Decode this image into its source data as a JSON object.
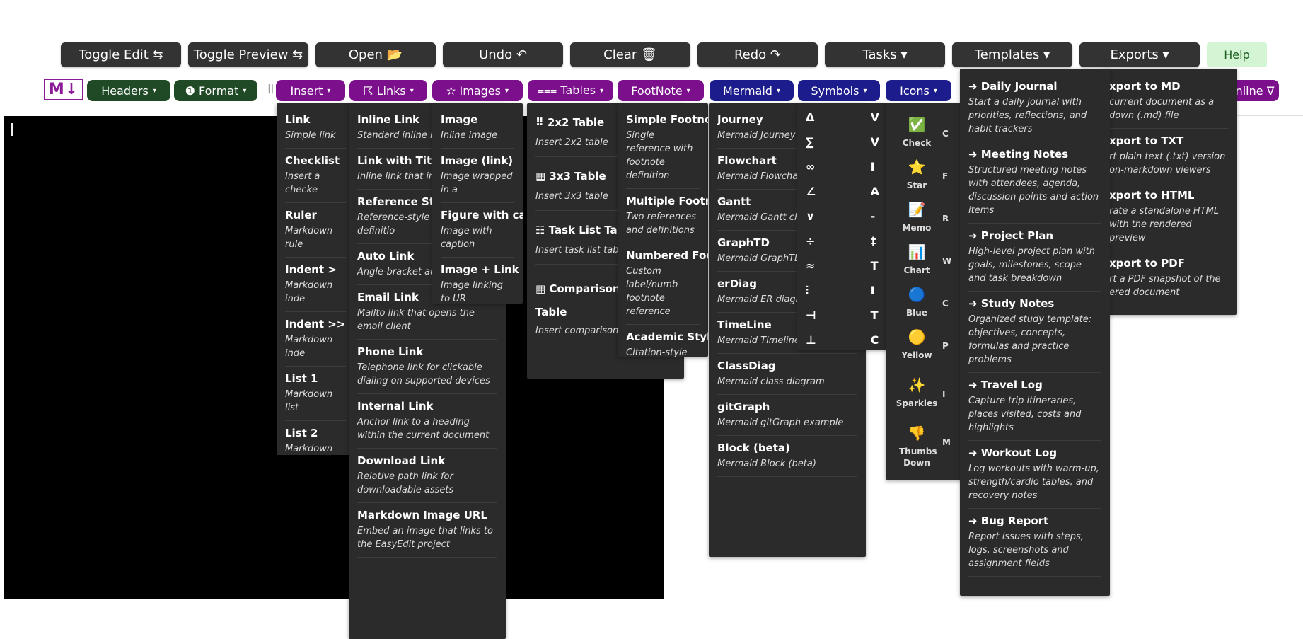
{
  "toolbar": {
    "toggle_edit": "Toggle Edit ⇆",
    "toggle_preview": "Toggle Preview ⇆",
    "open": "Open 📂",
    "undo": "Undo ↶",
    "clear": "Clear 🗑",
    "redo": "Redo ↷",
    "tasks": "Tasks ▾",
    "templates": "Templates ▾",
    "exports": "Exports ▾",
    "help": "Help"
  },
  "formatbar": {
    "logo": "M↓",
    "headers": "Headers",
    "format": "❶ Format",
    "insert": "Insert",
    "links": "☈ Links",
    "images": "✫ Images",
    "tables": "⩶ Tables",
    "footnote": "FootNote",
    "mermaid": "Mermaid",
    "symbols": "Symbols",
    "icons": "Icons",
    "inline": "nline ∇",
    "caret": "▾",
    "separator": "||"
  },
  "insert_menu": [
    {
      "title": "Link",
      "desc": "Simple link"
    },
    {
      "title": "Checklist",
      "desc": "Insert a checke"
    },
    {
      "title": "Ruler",
      "desc": "Markdown rule"
    },
    {
      "title": "Indent >",
      "desc": "Markdown inde"
    },
    {
      "title": "Indent >>",
      "desc": "Markdown inde"
    },
    {
      "title": "List 1",
      "desc": "Markdown list"
    },
    {
      "title": "List 2",
      "desc": "Markdown list"
    }
  ],
  "links_menu": [
    {
      "title": "Inline Link",
      "desc": "Standard inline m"
    },
    {
      "title": "Link with Title",
      "desc": "Inline link that inc (tooltip)"
    },
    {
      "title": "Reference Style",
      "desc": "Reference-style lin separate definitio"
    },
    {
      "title": "Auto Link",
      "desc": "Angle-bracket autolink"
    },
    {
      "title": "Email Link",
      "desc": "Mailto link that opens the email client"
    },
    {
      "title": "Phone Link",
      "desc": "Telephone link for clickable dialing on supported devices"
    },
    {
      "title": "Internal Link",
      "desc": "Anchor link to a heading within the current document"
    },
    {
      "title": "Download Link",
      "desc": "Relative path link for downloadable assets"
    },
    {
      "title": "Markdown Image URL",
      "desc": "Embed an image that links to the EasyEdit project"
    }
  ],
  "images_menu": [
    {
      "title": "Image",
      "desc": "Inline image"
    },
    {
      "title": "Image (link)",
      "desc": "Image wrapped in a"
    },
    {
      "title": "Figure with capti",
      "desc": "Image with caption"
    },
    {
      "title": "Image + Link (ne",
      "desc": "Image linking to UR"
    }
  ],
  "tables_menu": [
    {
      "title": "⠿ 2x2 Table",
      "desc": "Insert 2x2 table"
    },
    {
      "title": "▦ 3x3 Table",
      "desc": "Insert 3x3 table"
    },
    {
      "title": "☷ Task List Table",
      "desc": "Insert task list table"
    },
    {
      "title": "▦ Comparison Table",
      "desc": "Insert comparison table"
    }
  ],
  "footnote_menu": [
    {
      "title": "Simple Footnote",
      "desc": "Single reference with footnote definition"
    },
    {
      "title": "Multiple Footno",
      "desc": "Two references and definitions"
    },
    {
      "title": "Numbered Foot",
      "desc": "Custom label/numb footnote reference"
    },
    {
      "title": "Academic Style",
      "desc": "Citation-style footn bibliographic examp"
    }
  ],
  "mermaid_menu": [
    {
      "title": "Journey",
      "desc": "Mermaid Journey e"
    },
    {
      "title": "Flowchart",
      "desc": "Mermaid Flowchar"
    },
    {
      "title": "Gantt",
      "desc": "Mermaid Gantt ch"
    },
    {
      "title": "GraphTD",
      "desc": "Mermaid GraphTD"
    },
    {
      "title": "erDiag",
      "desc": "Mermaid ER diagra"
    },
    {
      "title": "TimeLine",
      "desc": "Mermaid Timeline example"
    },
    {
      "title": "ClassDiag",
      "desc": "Mermaid class diagram"
    },
    {
      "title": "gitGraph",
      "desc": "Mermaid gitGraph example"
    },
    {
      "title": "Block (beta)",
      "desc": "Mermaid Block (beta)"
    }
  ],
  "symbols_menu": [
    "Δ",
    "∑",
    "∞",
    "∠",
    "∨",
    "÷",
    "≈",
    "⫶",
    "⊣",
    "⊥"
  ],
  "symbols_menu_col2": [
    "V",
    "V",
    "I",
    "A",
    "-",
    "‡",
    "T",
    "I",
    "T",
    "C"
  ],
  "icons_menu": [
    {
      "glyph": "✅",
      "label": "Check"
    },
    {
      "glyph": "⭐",
      "label": "Star"
    },
    {
      "glyph": "📝",
      "label": "Memo"
    },
    {
      "glyph": "📊",
      "label": "Chart"
    },
    {
      "glyph": "🔵",
      "label": "Blue"
    },
    {
      "glyph": "🟡",
      "label": "Yellow"
    },
    {
      "glyph": "✨",
      "label": "Sparkles"
    },
    {
      "glyph": "👎",
      "label": "Thumbs Down"
    }
  ],
  "icons_menu_col2": [
    "C",
    "F",
    "R",
    "W",
    "C",
    "P",
    "I",
    "M"
  ],
  "templates_menu": [
    {
      "title": "➜ Daily Journal",
      "desc": "Start a daily journal with priorities, reflections, and habit trackers"
    },
    {
      "title": "➜ Meeting Notes",
      "desc": "Structured meeting notes with attendees, agenda, discussion points and action items"
    },
    {
      "title": "➜ Project Plan",
      "desc": "High-level project plan with goals, milestones, scope and task breakdown"
    },
    {
      "title": "➜ Study Notes",
      "desc": "Organized study template: objectives, concepts, formulas and practice problems"
    },
    {
      "title": "➜ Travel Log",
      "desc": "Capture trip itineraries, places visited, costs and highlights"
    },
    {
      "title": "➜ Workout Log",
      "desc": "Log workouts with warm-up, strength/cardio tables, and recovery notes"
    },
    {
      "title": "➜ Bug Report",
      "desc": "Report issues with steps, logs, screenshots and assignment fields"
    }
  ],
  "exports_menu": [
    {
      "title": "xport to MD",
      "desc": "current document as a down (.md) file"
    },
    {
      "title": "xport to TXT",
      "desc": "rt plain text (.txt) version on-markdown viewers"
    },
    {
      "title": "xport to HTML",
      "desc": "rate a standalone HTML with the rendered preview"
    },
    {
      "title": "xport to PDF",
      "desc": "rt a PDF snapshot of the ered document"
    }
  ]
}
